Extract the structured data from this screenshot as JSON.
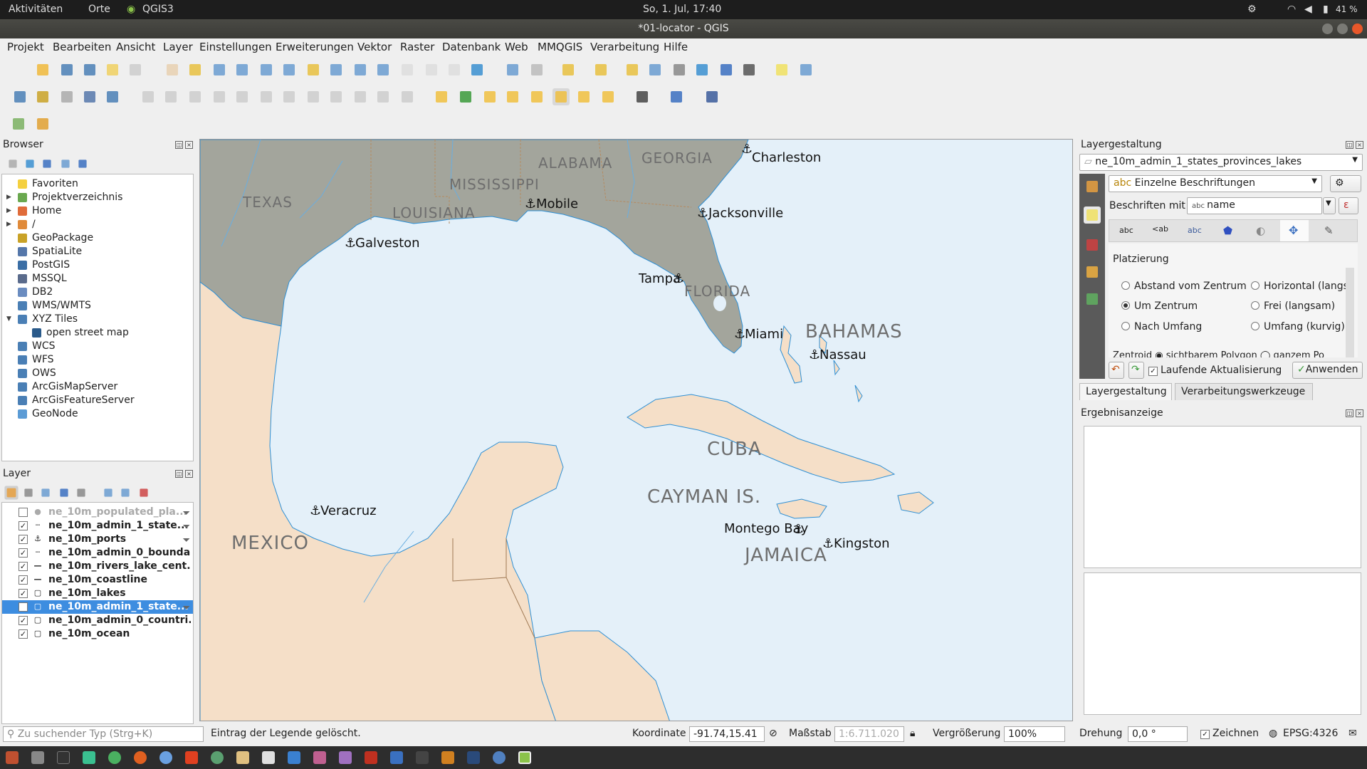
{
  "system_bar": {
    "activities": "Aktivitäten",
    "places": "Orte",
    "app": "QGIS3",
    "clock": "So,  1. Jul, 17:40",
    "battery": "41 %"
  },
  "window": {
    "title": "*01-locator - QGIS"
  },
  "menu": [
    "Projekt",
    "Bearbeiten",
    "Ansicht",
    "Layer",
    "Einstellungen",
    "Erweiterungen",
    "Vektor",
    "Raster",
    "Datenbank",
    "Web",
    "MMQGIS",
    "Verarbeitung",
    "Hilfe"
  ],
  "browser": {
    "title": "Browser",
    "items": [
      {
        "label": "Favoriten",
        "icon": "star-icon",
        "color": "#f4d03f",
        "arrow": ""
      },
      {
        "label": "Projektverzeichnis",
        "icon": "project-folder-icon",
        "color": "#6aa84f",
        "arrow": "▶"
      },
      {
        "label": "Home",
        "icon": "home-folder-icon",
        "color": "#e06c3a",
        "arrow": "▶"
      },
      {
        "label": "/",
        "icon": "root-folder-icon",
        "color": "#e08a3a",
        "arrow": "▶"
      },
      {
        "label": "GeoPackage",
        "icon": "geopackage-icon",
        "color": "#c9a227",
        "arrow": ""
      },
      {
        "label": "SpatiaLite",
        "icon": "spatialite-icon",
        "color": "#5577aa",
        "arrow": ""
      },
      {
        "label": "PostGIS",
        "icon": "postgis-icon",
        "color": "#3a6ea5",
        "arrow": ""
      },
      {
        "label": "MSSQL",
        "icon": "mssql-icon",
        "color": "#5a6b8c",
        "arrow": ""
      },
      {
        "label": "DB2",
        "icon": "db2-icon",
        "color": "#6a8cc0",
        "arrow": ""
      },
      {
        "label": "WMS/WMTS",
        "icon": "wms-globe-icon",
        "color": "#4a7fb5",
        "arrow": ""
      },
      {
        "label": "XYZ Tiles",
        "icon": "xyz-globe-icon",
        "color": "#4a7fb5",
        "arrow": "▼"
      },
      {
        "label": "open street map",
        "icon": "tile-layer-icon",
        "color": "#2a5a8a",
        "arrow": "",
        "indent": true
      },
      {
        "label": "WCS",
        "icon": "wcs-globe-icon",
        "color": "#4a7fb5",
        "arrow": ""
      },
      {
        "label": "WFS",
        "icon": "wfs-globe-icon",
        "color": "#4a7fb5",
        "arrow": ""
      },
      {
        "label": "OWS",
        "icon": "ows-globe-icon",
        "color": "#4a7fb5",
        "arrow": ""
      },
      {
        "label": "ArcGisMapServer",
        "icon": "arcgis-map-icon",
        "color": "#4a7fb5",
        "arrow": ""
      },
      {
        "label": "ArcGisFeatureServer",
        "icon": "arcgis-feature-icon",
        "color": "#4a7fb5",
        "arrow": ""
      },
      {
        "label": "GeoNode",
        "icon": "geonode-icon",
        "color": "#5b9bd5",
        "arrow": ""
      }
    ]
  },
  "layers": {
    "title": "Layer",
    "items": [
      {
        "label": "ne_10m_populated_pla...",
        "checked": false,
        "symbol": "●",
        "filter": true,
        "dim": true
      },
      {
        "label": "ne_10m_admin_1_state...",
        "checked": true,
        "symbol": "┄",
        "filter": true
      },
      {
        "label": "ne_10m_ports",
        "checked": true,
        "symbol": "⚓",
        "filter": true
      },
      {
        "label": "ne_10m_admin_0_bounda...",
        "checked": true,
        "symbol": "┄"
      },
      {
        "label": "ne_10m_rivers_lake_cent...",
        "checked": true,
        "symbol": "—"
      },
      {
        "label": "ne_10m_coastline",
        "checked": true,
        "symbol": "—"
      },
      {
        "label": "ne_10m_lakes",
        "checked": true,
        "symbol": "▢"
      },
      {
        "label": "ne_10m_admin_1_state...",
        "checked": true,
        "symbol": "▢",
        "selected": true,
        "filter": true
      },
      {
        "label": "ne_10m_admin_0_countri...",
        "checked": true,
        "symbol": "▢"
      },
      {
        "label": "ne_10m_ocean",
        "checked": true,
        "symbol": "▢"
      }
    ]
  },
  "map": {
    "countries": [
      "TEXAS",
      "LOUISIANA",
      "MISSISSIPPI",
      "ALABAMA",
      "GEORGIA",
      "FLORIDA",
      "BAHAMAS",
      "CUBA",
      "CAYMAN IS.",
      "JAMAICA",
      "MEXICO"
    ],
    "cities": [
      "Charleston",
      "Mobile",
      "Jacksonville",
      "Galveston",
      "Tampa",
      "Miami",
      "Nassau",
      "Veracruz",
      "Montego Bay",
      "Kingston"
    ]
  },
  "styling": {
    "title": "Layergestaltung",
    "layer_combo": "ne_10m_admin_1_states_provinces_lakes",
    "mode_combo": "Einzelne Beschriftungen",
    "label_with": "Beschriften mit",
    "field_combo": "name",
    "placement_title": "Platzierung",
    "radios": [
      {
        "label": "Abstand vom Zentrum",
        "on": false
      },
      {
        "label": "Horizontal (langs",
        "on": false
      },
      {
        "label": "Um Zentrum",
        "on": true
      },
      {
        "label": "Frei (langsam)",
        "on": false
      },
      {
        "label": "Nach Umfang",
        "on": false
      },
      {
        "label": "Umfang (kurvig)",
        "on": false
      }
    ],
    "cut_row": "Zentroid  ◉ sichtbarem Polygon   ◯ ganzem Po",
    "live_update": "Laufende Aktualisierung",
    "apply": "Anwenden",
    "tabs": [
      "Layergestaltung",
      "Verarbeitungswerkzeuge"
    ],
    "sub_tabs": [
      "abc",
      "<ab",
      "abc",
      "",
      "",
      "",
      ""
    ]
  },
  "results": {
    "title": "Ergebnisanzeige"
  },
  "status": {
    "locator_placeholder": "Zu suchender Typ (Strg+K)",
    "message": "Eintrag der Legende gelöscht.",
    "coord_label": "Koordinate",
    "coord": "-91.74,15.41",
    "scale_label": "Maßstab",
    "scale": "1:6.711.020",
    "zoom_label": "Vergrößerung",
    "zoom": "100%",
    "rotation_label": "Drehung",
    "rotation": "0,0 °",
    "render_label": "Zeichnen",
    "crs": "EPSG:4326"
  }
}
